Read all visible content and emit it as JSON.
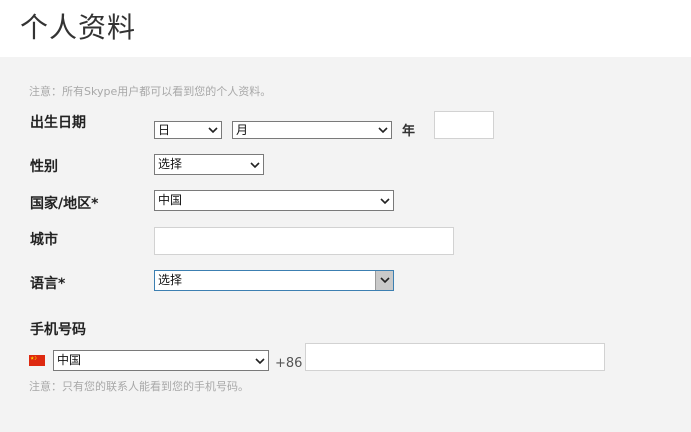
{
  "header": {
    "title": "个人资料"
  },
  "notices": {
    "top": "注意：所有Skype用户都可以看到您的个人资料。",
    "phone": "注意：只有您的联系人能看到您的手机号码。"
  },
  "birthday": {
    "label": "出生日期",
    "day_value": "日",
    "month_value": "月",
    "year_label": "年",
    "year_value": ""
  },
  "gender": {
    "label": "性别",
    "value": "选择"
  },
  "country": {
    "label": "国家/地区*",
    "value": "中国"
  },
  "city": {
    "label": "城市",
    "value": ""
  },
  "language": {
    "label": "语言*",
    "value": "选择"
  },
  "phone": {
    "label": "手机号码",
    "country_value": "中国",
    "country_code": "+86",
    "number_value": "",
    "flag_icon": "china-flag-icon"
  },
  "colors": {
    "page_background": "#f3f3f3",
    "header_background": "#ffffff",
    "notice_text": "#a8a8a8",
    "focus_border": "#3c7fb1",
    "flag_red": "#de2910",
    "flag_yellow": "#ffde00"
  }
}
